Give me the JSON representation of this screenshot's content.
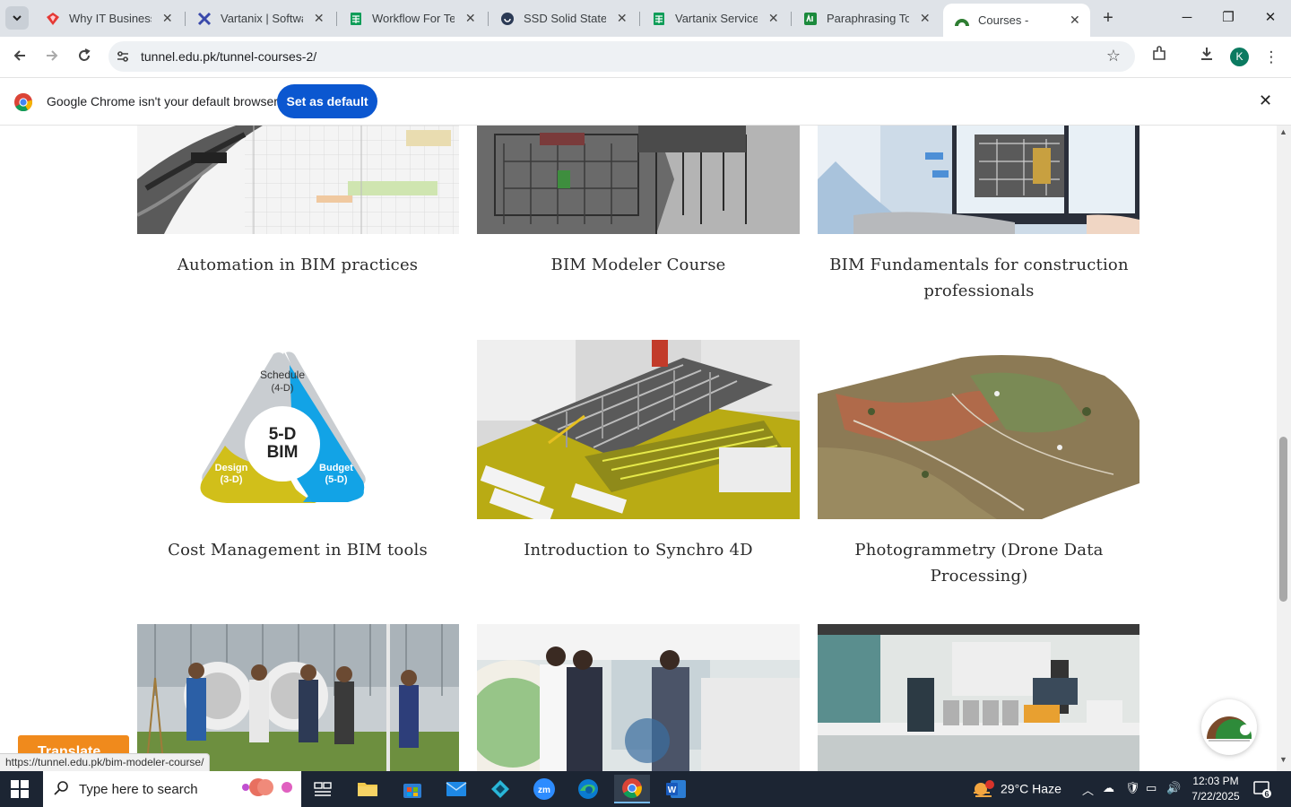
{
  "browser": {
    "tabs": [
      {
        "title": "Why IT Business M",
        "icon": "gem-icon",
        "color": "#e53935"
      },
      {
        "title": "Vartanix | Software",
        "icon": "x-logo-icon",
        "color": "#3949ab"
      },
      {
        "title": "Workflow For Team",
        "icon": "sheets-icon",
        "color": "#0f9d58"
      },
      {
        "title": "SSD Solid State Dr",
        "icon": "ssd-site-icon",
        "color": "#2b3a55"
      },
      {
        "title": "Vartanix Services S",
        "icon": "sheets-icon",
        "color": "#0f9d58"
      },
      {
        "title": "Paraphrasing Tool",
        "icon": "paraphrase-icon",
        "color": "#1b8a3c"
      },
      {
        "title": "Courses -",
        "icon": "tunnel-logo-icon",
        "color": "#2e7d32",
        "active": true
      }
    ],
    "url": "tunnel.edu.pk/tunnel-courses-2/",
    "profile_initial": "K",
    "infobar": {
      "message": "Google Chrome isn't your default browser",
      "button": "Set as default"
    },
    "status_url": "https://tunnel.edu.pk/bim-modeler-course/"
  },
  "courses": [
    {
      "title": "Automation in BIM practices"
    },
    {
      "title": "BIM Modeler Course"
    },
    {
      "title": "BIM Fundamentals for construction professionals"
    },
    {
      "title": "Cost Management in BIM tools",
      "diagram": {
        "top": "Schedule",
        "top_sub": "(4-D)",
        "center": "5-D",
        "center_sub": "BIM",
        "left": "Design",
        "left_sub": "(3-D)",
        "right": "Budget",
        "right_sub": "(5-D)"
      }
    },
    {
      "title": "Introduction to Synchro 4D"
    },
    {
      "title": "Photogrammetry (Drone Data Processing)"
    }
  ],
  "translate_label": "Translate",
  "taskbar": {
    "search_placeholder": "Type here to search",
    "weather": "29°C  Haze",
    "weather_badge": "1",
    "time": "12:03 PM",
    "date": "7/22/2025",
    "notification_count": "6"
  }
}
